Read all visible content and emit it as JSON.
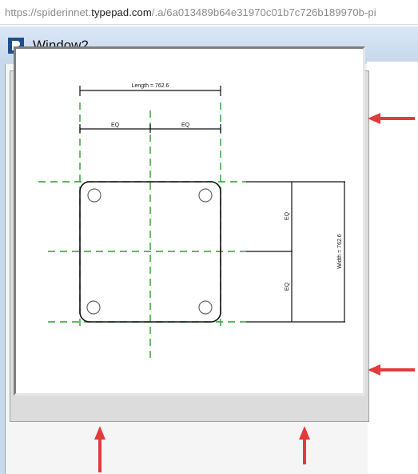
{
  "browser": {
    "url_prefix": "https://spiderinnet.",
    "url_host": "typepad.com",
    "url_suffix": "/.a/6a013489b64e31970c01b7c726b189970b-pi"
  },
  "window": {
    "title": "Window2",
    "icon": "revit-logo-icon"
  },
  "drawing": {
    "dim_top_total": "Length = 762.6",
    "dim_top_left": "EQ",
    "dim_top_right": "EQ",
    "dim_right_top": "EQ",
    "dim_right_bottom": "EQ",
    "dim_right_total": "Width = 762.6"
  },
  "annotations": {
    "arrow_color": "#e23b3b",
    "gridline_color": "#2e9e2e"
  }
}
